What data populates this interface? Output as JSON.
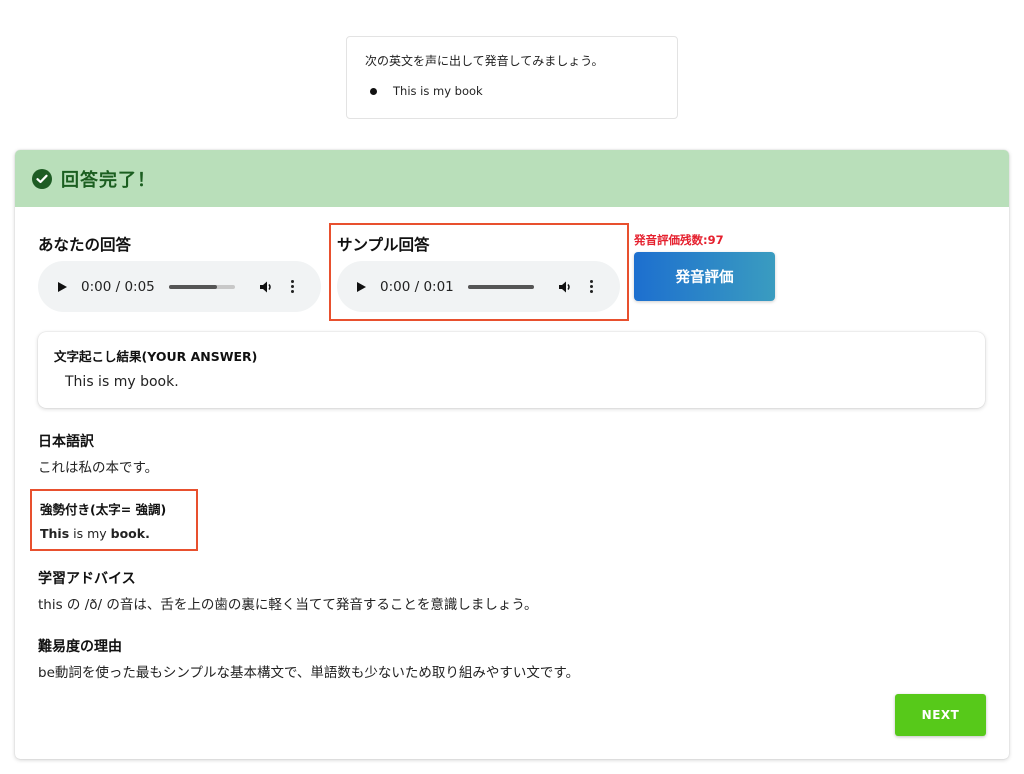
{
  "question": {
    "instruction": "次の英文を声に出して発音してみましょう。",
    "sentence": "This is my book"
  },
  "result": {
    "title": "回答完了！",
    "colors": {
      "header_bg": "#b9dfba",
      "header_text": "#1b5e20",
      "highlight_border": "#e8502e",
      "next": "#57c91a"
    }
  },
  "your_answer": {
    "heading": "あなたの回答",
    "audio": {
      "time": "0:00 / 0:05",
      "progress_fraction": 0.72
    }
  },
  "sample_answer": {
    "heading": "サンプル回答",
    "audio": {
      "time": "0:00 / 0:01",
      "progress_fraction": 1.0
    }
  },
  "evaluation": {
    "remaining_label": "発音評価残数:97",
    "button_label": "発音評価"
  },
  "transcript": {
    "label": "文字起こし結果(YOUR ANSWER)",
    "text": "This is my book."
  },
  "translation": {
    "title": "日本語訳",
    "text": "これは私の本です。"
  },
  "emphasis": {
    "title": "強勢付き(太字= 強調)",
    "parts": [
      {
        "text": "This",
        "bold": true
      },
      {
        "text": " is my ",
        "bold": false
      },
      {
        "text": "book.",
        "bold": true
      }
    ]
  },
  "advice": {
    "title": "学習アドバイス",
    "text": "this の /ð/ の音は、舌を上の歯の裏に軽く当てて発音することを意識しましょう。"
  },
  "difficulty": {
    "title": "難易度の理由",
    "text": "be動詞を使った最もシンプルな基本構文で、単語数も少ないため取り組みやすい文です。"
  },
  "next_label": "NEXT"
}
